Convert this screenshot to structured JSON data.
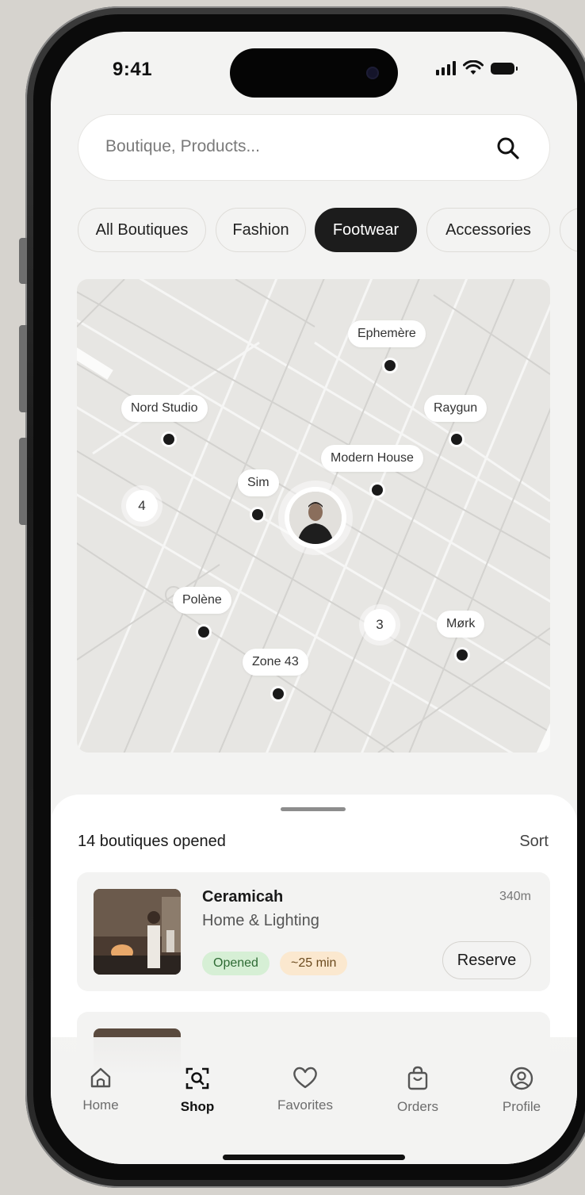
{
  "status_bar": {
    "time": "9:41"
  },
  "search": {
    "placeholder": "Boutique, Products..."
  },
  "categories": [
    {
      "label": "All Boutiques",
      "active": false
    },
    {
      "label": "Fashion",
      "active": false
    },
    {
      "label": "Footwear",
      "active": true
    },
    {
      "label": "Accessories",
      "active": false
    }
  ],
  "map": {
    "pins": [
      {
        "label": "Ephemère"
      },
      {
        "label": "Nord Studio"
      },
      {
        "label": "Raygun"
      },
      {
        "label": "Modern House"
      },
      {
        "label": "Sim"
      },
      {
        "label": "Polène"
      },
      {
        "label": "Mørk"
      },
      {
        "label": "Zone 43"
      }
    ],
    "clusters": [
      {
        "count": "4"
      },
      {
        "count": "3"
      }
    ]
  },
  "sheet": {
    "title": "14 boutiques opened",
    "sort_label": "Sort",
    "boutiques": [
      {
        "name": "Ceramicah",
        "category": "Home & Lighting",
        "distance": "340m",
        "status": "Opened",
        "eta": "~25 min",
        "action": "Reserve"
      }
    ]
  },
  "tabbar": {
    "tabs": [
      {
        "label": "Home",
        "icon": "home-icon",
        "active": false
      },
      {
        "label": "Shop",
        "icon": "shop-scan-icon",
        "active": true
      },
      {
        "label": "Favorites",
        "icon": "heart-icon",
        "active": false
      },
      {
        "label": "Orders",
        "icon": "shopping-bag-icon",
        "active": false
      },
      {
        "label": "Profile",
        "icon": "profile-icon",
        "active": false
      }
    ]
  },
  "colors": {
    "background": "#d6d3ce",
    "screen": "#f3f3f2",
    "accent": "#1c1c1c",
    "opened_badge": "#d6efd5",
    "eta_badge": "#fbe8cf"
  }
}
